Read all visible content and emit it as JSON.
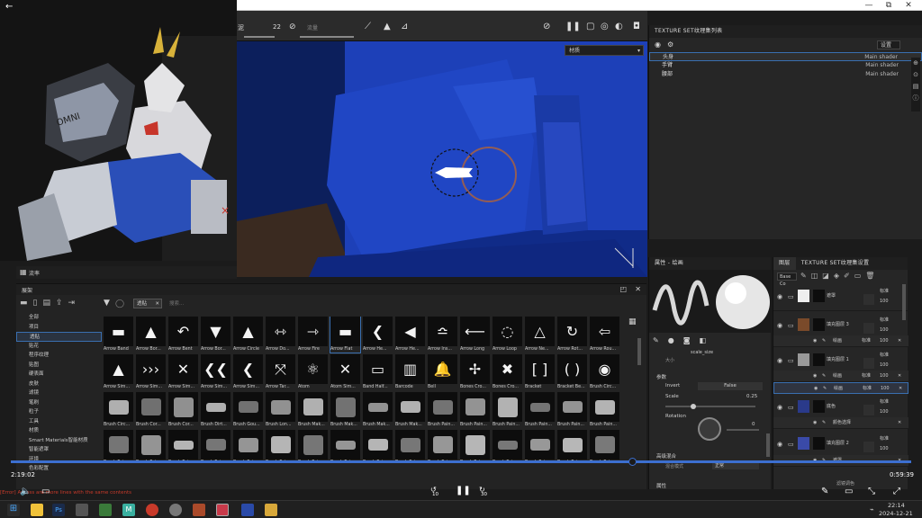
{
  "window": {
    "restore_glyph": "⧉",
    "minimize_glyph": "—",
    "close_glyph": "✕"
  },
  "toolbar": {
    "size_value": "22",
    "left_fragment": "泥",
    "flow_fragment": "流量"
  },
  "viewport": {
    "mode_select": "材质"
  },
  "texture_set_list": {
    "title": "TEXTURE SET纹理集列表",
    "settings_label": "设置",
    "rows": [
      {
        "name": "头身",
        "shader": "Main shader"
      },
      {
        "name": "手臂",
        "shader": "Main shader"
      },
      {
        "name": "腰部",
        "shader": "Main shader"
      }
    ]
  },
  "properties": {
    "title": "属性 - 绘画",
    "scale_size_label": "scale_size",
    "size_label": "大小",
    "section_params": "参数",
    "invert_label": "Invert",
    "invert_value": "False",
    "scale_label": "Scale",
    "scale_value": "0.25",
    "rotation_label": "Rotation",
    "rotation_value": "0",
    "section_blend": "高级混合",
    "blend_mode_label": "混合模式",
    "blend_mode_value": "正常",
    "section_more": "属性"
  },
  "layers": {
    "tab_layers": "图层",
    "tab_settings": "TEXTURE SET纹理集设置",
    "channel_select": "Base Co",
    "rows": [
      {
        "name": "遮罩",
        "blend": "标准",
        "opacity": "100"
      },
      {
        "name": "填充图层 3",
        "blend": "标准",
        "opacity": "100"
      },
      {
        "name": "填充图层 1",
        "blend": "标准",
        "opacity": "100"
      },
      {
        "name": "底色",
        "blend": "标准",
        "opacity": "100"
      },
      {
        "name": "填充图层 2",
        "blend": "标准",
        "opacity": "100"
      }
    ],
    "sub_rows": [
      {
        "name": "绘画",
        "blend": "标准",
        "opacity": "100"
      },
      {
        "name": "绘画",
        "blend": "标准",
        "opacity": "100"
      },
      {
        "name": "绘画",
        "blend": "标准",
        "opacity": "100"
      },
      {
        "name": "颜色选择",
        "blend": "",
        "opacity": ""
      },
      {
        "name": "遮罩",
        "blend": "",
        "opacity": ""
      }
    ],
    "footer": "滤镜调色"
  },
  "shelf": {
    "tab_label": "流率",
    "panel_title": "展架",
    "filter_tag": "透贴",
    "search_placeholder": "搜索...",
    "categories": [
      "全部",
      "项目",
      "透贴",
      "贴花",
      "程序纹理",
      "贴图",
      "硬表面",
      "皮肤",
      "滤镜",
      "笔刷",
      "粒子",
      "工具",
      "材质",
      "Smart Materials智能材质",
      "智能遮罩",
      "环境",
      "色彩配置"
    ],
    "selected_category": 2,
    "tiles": [
      "Arrow Band",
      "Arrow Bor...",
      "Arrow Bent",
      "Arrow Bor...",
      "Arrow Circle",
      "Arrow Do...",
      "Arrow Fire",
      "Arrow Flat",
      "Arrow He...",
      "Arrow He...",
      "Arrow Ins...",
      "Arrow Long",
      "Arrow Loop",
      "Arrow Ne...",
      "Arrow Rot...",
      "Arrow Rou...",
      "Arrow Sim...",
      "Arrow Sim...",
      "Arrow Sim...",
      "Arrow Sim...",
      "Arrow Sim...",
      "Arrow Tar...",
      "Atom",
      "Atom Sim...",
      "Band Half...",
      "Barcode",
      "Bell",
      "Bones Cro...",
      "Bones Cro...",
      "Bracket",
      "Bracket Be...",
      "Brush Circ...",
      "Brush Circ...",
      "Brush Cor...",
      "Brush Cor...",
      "Brush Dirt...",
      "Brush Gou...",
      "Brush Lon...",
      "Brush Mak...",
      "Brush Mak...",
      "Brush Mak...",
      "Brush Mak...",
      "Brush Pain...",
      "Brush Pain...",
      "Brush Pain...",
      "Brush Pain...",
      "Brush Pain...",
      "Brush Pain...",
      "Brush Pain...",
      "Brush Pain...",
      "Brush Pain...",
      "Brush Pain...",
      "Brush Pain...",
      "Brush Pain...",
      "Brush Pain...",
      "Brush Pain...",
      "Brush Pain...",
      "Brush Pain...",
      "Brush Pain...",
      "Brush Pain...",
      "Brush Pain...",
      "Brush Pai...",
      "Brush Pai...",
      "Brush Pai..."
    ]
  },
  "player": {
    "elapsed": "2:19:02",
    "remaining": "0:59:39",
    "progress": 0.69,
    "status_line": "[Error] Access are more lines with the same contents",
    "skip_back": "10",
    "skip_forward": "30"
  },
  "taskbar": {
    "time": "22:14",
    "date": "2024-12-21"
  },
  "colors": {
    "accent": "#3c6fd0",
    "panel": "#262626",
    "viewport": "#132f92"
  }
}
